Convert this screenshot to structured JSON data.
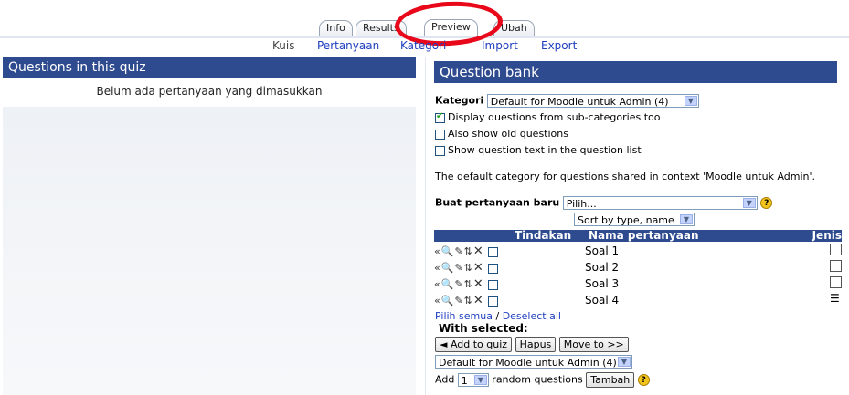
{
  "tabs": [
    "Info",
    "Results",
    "Preview",
    "Ubah"
  ],
  "subnav": {
    "current": "Kuis",
    "links": [
      "Pertanyaan",
      "Kategori",
      "Import",
      "Export"
    ]
  },
  "left": {
    "title": "Questions in this quiz",
    "empty_text": "Belum ada pertanyaan yang dimasukkan"
  },
  "right": {
    "title": "Question bank",
    "category_label": "Kategori",
    "category_value": "Default for Moodle untuk Admin (4)",
    "options": [
      {
        "label": "Display questions from sub-categories too",
        "checked": true
      },
      {
        "label": "Also show old questions",
        "checked": false
      },
      {
        "label": "Show question text in the question list",
        "checked": false
      }
    ],
    "category_info": "The default category for questions shared in context 'Moodle untuk Admin'.",
    "create_label": "Buat pertanyaan baru",
    "create_value": "Pilih...",
    "sort_value": "Sort by type, name",
    "columns": {
      "actions": "Tindakan",
      "name": "Nama pertanyaan",
      "type": "Jenis"
    },
    "questions": [
      {
        "name": "Soal 1",
        "type_icon": "blank-square-icon"
      },
      {
        "name": "Soal 2",
        "type_icon": "blank-square-icon"
      },
      {
        "name": "Soal 3",
        "type_icon": "blank-square-icon"
      },
      {
        "name": "Soal 4",
        "type_icon": "list-icon"
      }
    ],
    "select_all": "Pilih semua",
    "separator": "/",
    "deselect_all": "Deselect all",
    "with_selected": "With selected:",
    "buttons": {
      "add_to_quiz": "◄ Add to quiz",
      "delete": "Hapus",
      "move_to": "Move to >>"
    },
    "move_target": "Default for Moodle untuk Admin (4)",
    "random": {
      "prefix": "Add",
      "count": "1",
      "suffix": "random questions",
      "button": "Tambah"
    }
  }
}
